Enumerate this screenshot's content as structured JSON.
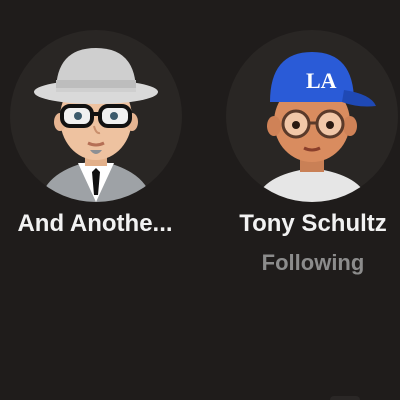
{
  "profiles": [
    {
      "name": "And Anothe...",
      "avatar": "memoji-hat-glasses-icon",
      "status": ""
    },
    {
      "name": "Tony Schultz",
      "avatar": "memoji-la-cap-glasses-icon",
      "status": "Following"
    }
  ],
  "colors": {
    "background": "#1f1c1b",
    "avatar_bg": "#292624",
    "name_text": "#f2f2f2",
    "status_text": "#8c8c8c",
    "cap_blue": "#2a5bd7"
  }
}
